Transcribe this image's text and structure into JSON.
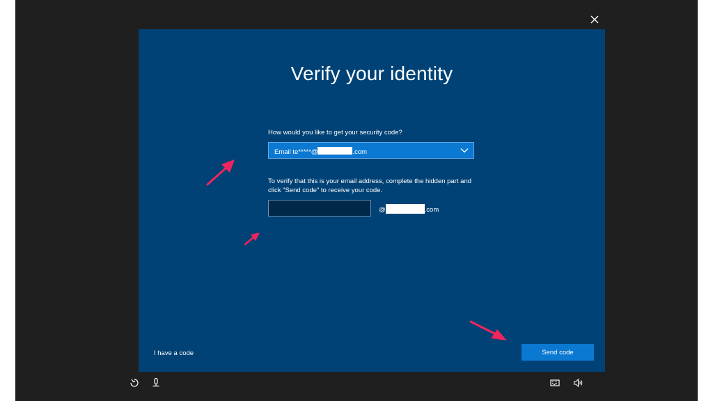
{
  "dialog": {
    "title": "Verify your identity",
    "method_question": "How would you like to get your security code?",
    "method_prefix": "Email te*****@",
    "method_suffix": ".com",
    "verify_instructions": "To verify that this is your email address, complete the hidden part and click \"Send code\" to receive your code.",
    "email_local_part_value": "",
    "domain_prefix": "@",
    "domain_suffix": ".com",
    "have_code_link": "I have a code",
    "send_code_button": "Send code"
  },
  "icons": {
    "close": "close-icon",
    "dropdown": "chevron-down-icon",
    "ease_of_access": "ease-of-access-icon",
    "microphone": "microphone-icon",
    "keyboard": "keyboard-icon",
    "volume": "volume-icon"
  },
  "colors": {
    "dialog_background": "#004275",
    "accent_blue": "#0b78d1",
    "annotation_arrow": "#f0245e",
    "frame_background": "#1f1f1f"
  }
}
